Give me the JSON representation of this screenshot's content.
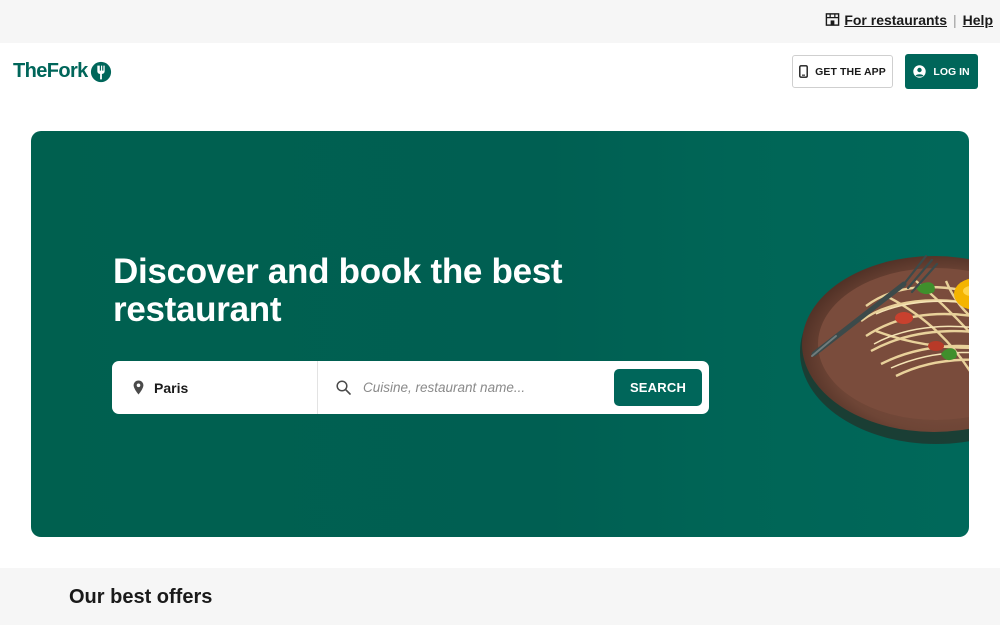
{
  "topbar": {
    "for_restaurants": "For restaurants",
    "separator": "|",
    "help": "Help",
    "store_icon": "store-icon"
  },
  "header": {
    "logo_text": "TheFork",
    "get_app_label": "GET THE APP",
    "login_label": "LOG IN",
    "phone_icon": "phone-icon",
    "user_icon": "user-icon"
  },
  "hero": {
    "title": "Discover and book the best restaurant",
    "location_value": "Paris",
    "search_placeholder": "Cuisine, restaurant name...",
    "search_button": "SEARCH",
    "pin_icon": "map-pin-icon",
    "search_icon": "search-icon"
  },
  "offers": {
    "title": "Our best offers"
  },
  "colors": {
    "brand": "#00665a",
    "hero_bg": "#005f52",
    "topbar_bg": "#f6f6f6"
  }
}
